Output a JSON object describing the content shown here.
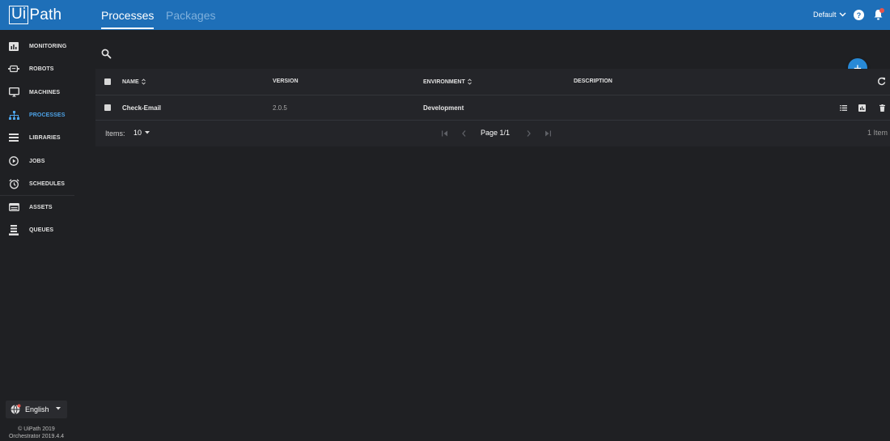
{
  "header": {
    "logo_text": "UiPath",
    "tabs": [
      {
        "label": "Processes"
      },
      {
        "label": "Packages"
      }
    ],
    "tenant": "Default"
  },
  "sidebar": {
    "items": [
      {
        "label": "MONITORING",
        "icon": "monitoring-icon"
      },
      {
        "label": "ROBOTS",
        "icon": "robot-icon"
      },
      {
        "label": "MACHINES",
        "icon": "machine-icon"
      },
      {
        "label": "PROCESSES",
        "icon": "processes-icon",
        "active": true
      },
      {
        "label": "LIBRARIES",
        "icon": "libraries-icon"
      },
      {
        "label": "JOBS",
        "icon": "jobs-icon"
      },
      {
        "label": "SCHEDULES",
        "icon": "schedules-icon"
      },
      {
        "label": "ASSETS",
        "icon": "assets-icon"
      },
      {
        "label": "QUEUES",
        "icon": "queues-icon"
      }
    ],
    "language": "English",
    "footer_line1": "© UiPath 2019",
    "footer_line2": "Orchestrator 2019.4.4"
  },
  "table": {
    "columns": {
      "name": "NAME",
      "version": "VERSION",
      "environment": "ENVIRONMENT",
      "description": "DESCRIPTION"
    },
    "rows": [
      {
        "name": "Check-Email",
        "version": "2.0.5",
        "environment": "Development",
        "description": ""
      }
    ],
    "footer": {
      "items_label": "Items:",
      "items_per_page": "10",
      "page_text": "Page 1/1",
      "count_text": "1 Item"
    }
  },
  "colors": {
    "topbar": "#1e6fb8",
    "accent": "#2889d6",
    "background": "#1f2023",
    "active_nav": "#4da3e8"
  }
}
